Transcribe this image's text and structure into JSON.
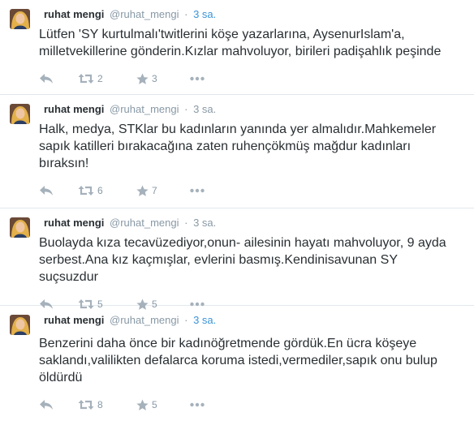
{
  "tweets": [
    {
      "fullname": "ruhat mengi",
      "username": "@ruhat_mengi",
      "separator": "·",
      "time": "3 sa.",
      "text": "Lütfen 'SY kurtulmalı'twitlerini köşe yazarlarına, AysenurIslam'a, milletvekillerine gönderin.Kızlar mahvoluyor, birileri padişahlık peşinde",
      "retweets": "2",
      "favorites": "3"
    },
    {
      "fullname": "ruhat mengi",
      "username": "@ruhat_mengi",
      "separator": "·",
      "time": "3 sa.",
      "text": "Halk, medya, STKlar bu kadınların yanında yer almalıdır.Mahkemeler sapık katilleri bırakacağına zaten ruhençökmüş mağdur kadınları bıraksın!",
      "retweets": "6",
      "favorites": "7"
    },
    {
      "fullname": "ruhat mengi",
      "username": "@ruhat_mengi",
      "separator": "·",
      "time": "3 sa.",
      "text": "Buolayda kıza tecavüzediyor,onun- ailesinin hayatı mahvoluyor, 9 ayda serbest.Ana kız kaçmışlar, evlerini basmış.Kendinisavunan SY suçsuzdur",
      "retweets": "5",
      "favorites": "5"
    },
    {
      "fullname": "ruhat mengi",
      "username": "@ruhat_mengi",
      "separator": "·",
      "time": "3 sa.",
      "text": "Benzerini daha önce bir kadınöğretmende gördük.En ücra köşeye saklandı,valilikten defalarca koruma istedi,vermediler,sapık onu bulup öldürdü",
      "retweets": "8",
      "favorites": "5"
    }
  ],
  "colors": {
    "name": "#292f33",
    "meta": "#8899a6",
    "link": "#3b94d9",
    "icon": "#a5b1bb",
    "divider": "#e1e8ed"
  },
  "icons": {
    "reply": "reply-icon",
    "retweet": "retweet-icon",
    "favorite": "star-icon",
    "more": "more-dots-icon",
    "avatar": "avatar"
  }
}
